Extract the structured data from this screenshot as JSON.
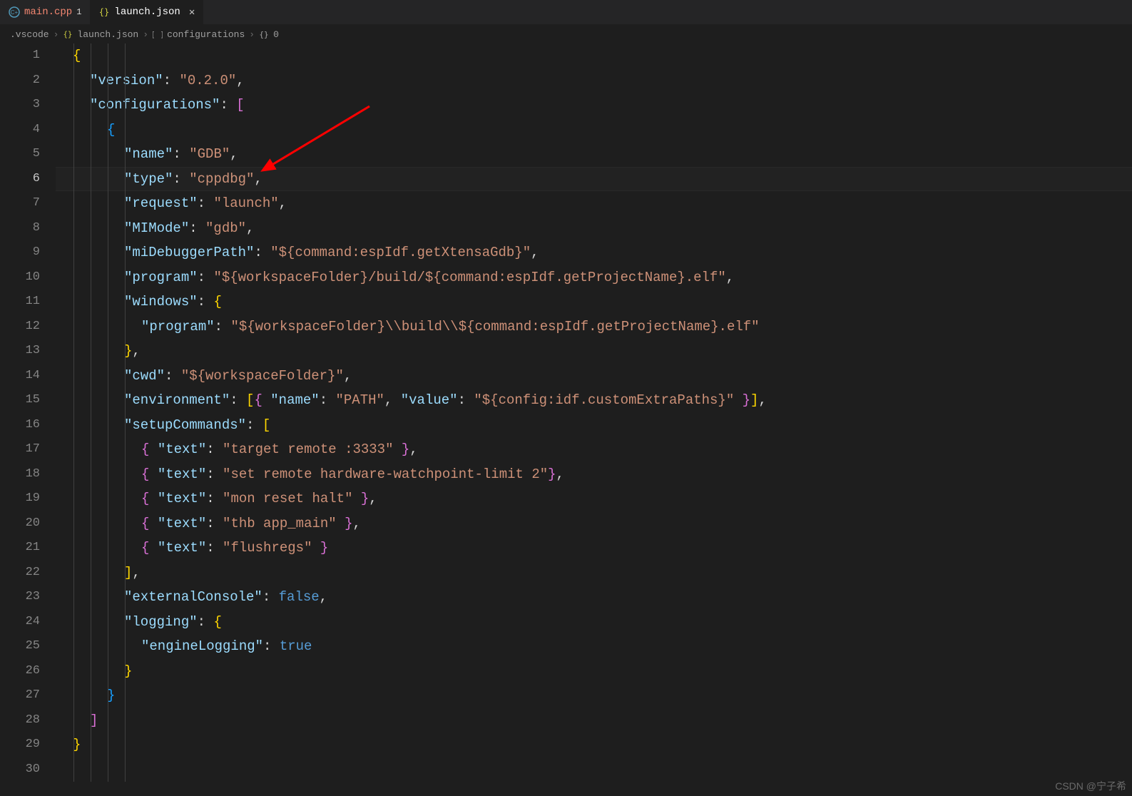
{
  "tabs": [
    {
      "icon": "cpp",
      "label": "main.cpp",
      "modified": "1",
      "active": false
    },
    {
      "icon": "json",
      "label": "launch.json",
      "active": true
    }
  ],
  "breadcrumb": {
    "parts": [
      {
        "icon": "",
        "text": ".vscode"
      },
      {
        "icon": "json",
        "text": "launch.json"
      },
      {
        "icon": "array",
        "text": "configurations"
      },
      {
        "icon": "object",
        "text": "0"
      }
    ]
  },
  "currentLine": 6,
  "lines": [
    {
      "n": 1,
      "indent": 0,
      "t": [
        [
          "brace",
          "{"
        ]
      ]
    },
    {
      "n": 2,
      "indent": 1,
      "t": [
        [
          "key",
          "\"version\""
        ],
        [
          "punc",
          ": "
        ],
        [
          "str",
          "\"0.2.0\""
        ],
        [
          "punc",
          ","
        ]
      ]
    },
    {
      "n": 3,
      "indent": 1,
      "t": [
        [
          "key",
          "\"configurations\""
        ],
        [
          "punc",
          ": "
        ],
        [
          "brace-1",
          "["
        ]
      ]
    },
    {
      "n": 4,
      "indent": 2,
      "t": [
        [
          "brace-2",
          "{"
        ]
      ]
    },
    {
      "n": 5,
      "indent": 3,
      "t": [
        [
          "key",
          "\"name\""
        ],
        [
          "punc",
          ": "
        ],
        [
          "str",
          "\"GDB\""
        ],
        [
          "punc",
          ","
        ]
      ]
    },
    {
      "n": 6,
      "indent": 3,
      "t": [
        [
          "key",
          "\"type\""
        ],
        [
          "punc",
          ": "
        ],
        [
          "str",
          "\"cppdbg\""
        ],
        [
          "punc",
          ","
        ]
      ]
    },
    {
      "n": 7,
      "indent": 3,
      "t": [
        [
          "key",
          "\"request\""
        ],
        [
          "punc",
          ": "
        ],
        [
          "str",
          "\"launch\""
        ],
        [
          "punc",
          ","
        ]
      ]
    },
    {
      "n": 8,
      "indent": 3,
      "t": [
        [
          "key",
          "\"MIMode\""
        ],
        [
          "punc",
          ": "
        ],
        [
          "str",
          "\"gdb\""
        ],
        [
          "punc",
          ","
        ]
      ]
    },
    {
      "n": 9,
      "indent": 3,
      "t": [
        [
          "key",
          "\"miDebuggerPath\""
        ],
        [
          "punc",
          ": "
        ],
        [
          "str",
          "\"${command:espIdf.getXtensaGdb}\""
        ],
        [
          "punc",
          ","
        ]
      ]
    },
    {
      "n": 10,
      "indent": 3,
      "t": [
        [
          "key",
          "\"program\""
        ],
        [
          "punc",
          ": "
        ],
        [
          "str",
          "\"${workspaceFolder}/build/${command:espIdf.getProjectName}.elf\""
        ],
        [
          "punc",
          ","
        ]
      ]
    },
    {
      "n": 11,
      "indent": 3,
      "t": [
        [
          "key",
          "\"windows\""
        ],
        [
          "punc",
          ": "
        ],
        [
          "brace-3",
          "{"
        ]
      ]
    },
    {
      "n": 12,
      "indent": 4,
      "t": [
        [
          "key",
          "\"program\""
        ],
        [
          "punc",
          ": "
        ],
        [
          "str",
          "\"${workspaceFolder}\\\\build\\\\${command:espIdf.getProjectName}.elf\""
        ]
      ]
    },
    {
      "n": 13,
      "indent": 3,
      "t": [
        [
          "brace-3",
          "}"
        ],
        [
          "punc",
          ","
        ]
      ]
    },
    {
      "n": 14,
      "indent": 3,
      "t": [
        [
          "key",
          "\"cwd\""
        ],
        [
          "punc",
          ": "
        ],
        [
          "str",
          "\"${workspaceFolder}\""
        ],
        [
          "punc",
          ","
        ]
      ]
    },
    {
      "n": 15,
      "indent": 3,
      "t": [
        [
          "key",
          "\"environment\""
        ],
        [
          "punc",
          ": "
        ],
        [
          "brace-3",
          "["
        ],
        [
          "brace-1",
          "{ "
        ],
        [
          "key",
          "\"name\""
        ],
        [
          "punc",
          ": "
        ],
        [
          "str",
          "\"PATH\""
        ],
        [
          "punc",
          ", "
        ],
        [
          "key",
          "\"value\""
        ],
        [
          "punc",
          ": "
        ],
        [
          "str",
          "\"${config:idf.customExtraPaths}\""
        ],
        [
          "brace-1",
          " }"
        ],
        [
          "brace-3",
          "]"
        ],
        [
          "punc",
          ","
        ]
      ]
    },
    {
      "n": 16,
      "indent": 3,
      "t": [
        [
          "key",
          "\"setupCommands\""
        ],
        [
          "punc",
          ": "
        ],
        [
          "brace-3",
          "["
        ]
      ]
    },
    {
      "n": 17,
      "indent": 4,
      "t": [
        [
          "brace-1",
          "{ "
        ],
        [
          "key",
          "\"text\""
        ],
        [
          "punc",
          ": "
        ],
        [
          "str",
          "\"target remote :3333\""
        ],
        [
          "brace-1",
          " }"
        ],
        [
          "punc",
          ","
        ]
      ]
    },
    {
      "n": 18,
      "indent": 4,
      "t": [
        [
          "brace-1",
          "{ "
        ],
        [
          "key",
          "\"text\""
        ],
        [
          "punc",
          ": "
        ],
        [
          "str",
          "\"set remote hardware-watchpoint-limit 2\""
        ],
        [
          "brace-1",
          "}"
        ],
        [
          "punc",
          ","
        ]
      ]
    },
    {
      "n": 19,
      "indent": 4,
      "t": [
        [
          "brace-1",
          "{ "
        ],
        [
          "key",
          "\"text\""
        ],
        [
          "punc",
          ": "
        ],
        [
          "str",
          "\"mon reset halt\""
        ],
        [
          "brace-1",
          " }"
        ],
        [
          "punc",
          ","
        ]
      ]
    },
    {
      "n": 20,
      "indent": 4,
      "t": [
        [
          "brace-1",
          "{ "
        ],
        [
          "key",
          "\"text\""
        ],
        [
          "punc",
          ": "
        ],
        [
          "str",
          "\"thb app_main\""
        ],
        [
          "brace-1",
          " }"
        ],
        [
          "punc",
          ","
        ]
      ]
    },
    {
      "n": 21,
      "indent": 4,
      "t": [
        [
          "brace-1",
          "{ "
        ],
        [
          "key",
          "\"text\""
        ],
        [
          "punc",
          ": "
        ],
        [
          "str",
          "\"flushregs\""
        ],
        [
          "brace-1",
          " }"
        ]
      ]
    },
    {
      "n": 22,
      "indent": 3,
      "t": [
        [
          "brace-3",
          "]"
        ],
        [
          "punc",
          ","
        ]
      ]
    },
    {
      "n": 23,
      "indent": 3,
      "t": [
        [
          "key",
          "\"externalConsole\""
        ],
        [
          "punc",
          ": "
        ],
        [
          "bool",
          "false"
        ],
        [
          "punc",
          ","
        ]
      ]
    },
    {
      "n": 24,
      "indent": 3,
      "t": [
        [
          "key",
          "\"logging\""
        ],
        [
          "punc",
          ": "
        ],
        [
          "brace-3",
          "{"
        ]
      ]
    },
    {
      "n": 25,
      "indent": 4,
      "t": [
        [
          "key",
          "\"engineLogging\""
        ],
        [
          "punc",
          ": "
        ],
        [
          "bool",
          "true"
        ]
      ]
    },
    {
      "n": 26,
      "indent": 3,
      "t": [
        [
          "brace-3",
          "}"
        ]
      ]
    },
    {
      "n": 27,
      "indent": 2,
      "t": [
        [
          "brace-2",
          "}"
        ]
      ]
    },
    {
      "n": 28,
      "indent": 1,
      "t": [
        [
          "brace-1",
          "]"
        ]
      ]
    },
    {
      "n": 29,
      "indent": 0,
      "t": [
        [
          "brace",
          "}"
        ]
      ]
    },
    {
      "n": 30,
      "indent": 0,
      "t": []
    }
  ],
  "watermark": "CSDN @宁子希"
}
